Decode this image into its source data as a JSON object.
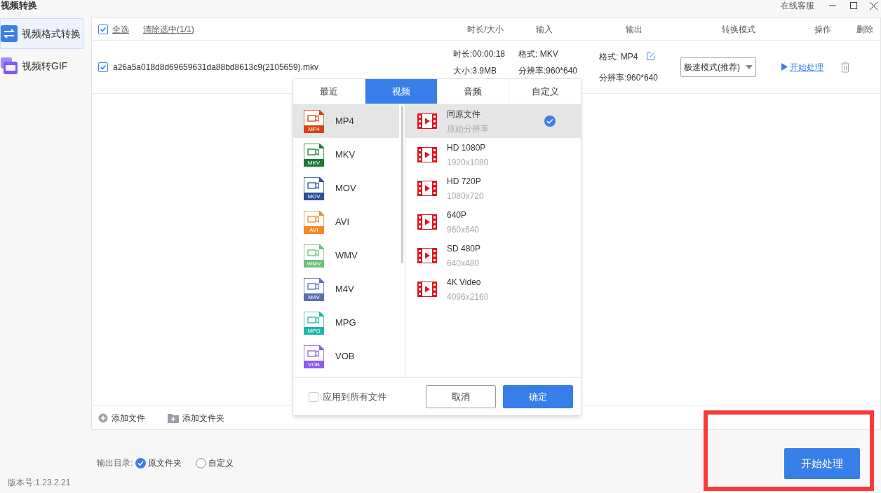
{
  "window": {
    "title": "视频转换",
    "support": "在线客服"
  },
  "sidebar": {
    "items": [
      {
        "label": "视频格式转换",
        "kind": "convert",
        "selected": true
      },
      {
        "label": "视频转GIF",
        "kind": "gif",
        "selected": false
      }
    ]
  },
  "toolbar": {
    "select_all": {
      "label": "全选",
      "checked": true
    },
    "clear": "清除选中(1/1)"
  },
  "table": {
    "columns": [
      "时长/大小",
      "输入",
      "输出",
      "转换模式",
      "操作",
      "删除"
    ],
    "rows": [
      {
        "checked": true,
        "name": "a26a5a018d8d69659631da88bd8613c9(2105659).mkv",
        "duration": "时长:00:00:18",
        "size": "大小:3.9MB",
        "input_format": "格式: MKV",
        "input_resolution": "分辨率:960*640",
        "output_format": "格式: MP4",
        "output_resolution": "分辨率:960*640",
        "mode": "极速模式(推荐)",
        "action": "开始处理"
      }
    ]
  },
  "footer_actions": [
    "添加文件",
    "添加文件夹"
  ],
  "output": {
    "label": "输出目录:",
    "options": [
      {
        "label": "原文件夹",
        "selected": true
      },
      {
        "label": "自定义",
        "selected": false
      }
    ]
  },
  "version": "版本号:1.23.2.21",
  "start_button": "开始处理",
  "popup": {
    "tabs": [
      {
        "label": "最近",
        "selected": false
      },
      {
        "label": "视频",
        "selected": true
      },
      {
        "label": "音频",
        "selected": false
      },
      {
        "label": "自定义",
        "selected": false
      }
    ],
    "formats": [
      {
        "label": "MP4",
        "badge": "MP4",
        "color": "#d84315",
        "selected": true
      },
      {
        "label": "MKV",
        "badge": "MKV",
        "color": "#1b7a3a",
        "selected": false
      },
      {
        "label": "MOV",
        "badge": "MOV",
        "color": "#2d4f9c",
        "selected": false
      },
      {
        "label": "AVI",
        "badge": "AVI",
        "color": "#f08a24",
        "selected": false
      },
      {
        "label": "WMV",
        "badge": "WMV",
        "color": "#6cc07a",
        "selected": false
      },
      {
        "label": "M4V",
        "badge": "M4V",
        "color": "#5a6fb5",
        "selected": false
      },
      {
        "label": "MPG",
        "badge": "MPG",
        "color": "#1fb5a8",
        "selected": false
      },
      {
        "label": "VOB",
        "badge": "VOB",
        "color": "#8a5cf0",
        "selected": false
      }
    ],
    "presets": [
      {
        "name": "同原文件",
        "resolution": "原始分辨率",
        "selected": true
      },
      {
        "name": "HD 1080P",
        "resolution": "1920x1080",
        "selected": false
      },
      {
        "name": "HD 720P",
        "resolution": "1080x720",
        "selected": false
      },
      {
        "name": "640P",
        "resolution": "960x640",
        "selected": false
      },
      {
        "name": "SD 480P",
        "resolution": "640x480",
        "selected": false
      },
      {
        "name": "4K Video",
        "resolution": "4096x2160",
        "selected": false
      }
    ],
    "apply_all": {
      "label": "应用到所有文件",
      "checked": false
    },
    "cancel": "取消",
    "confirm": "确定"
  }
}
